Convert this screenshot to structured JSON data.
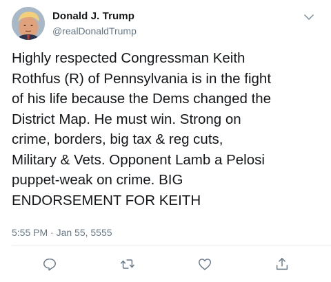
{
  "author": {
    "display_name": "Donald J. Trump",
    "handle": "@realDonaldTrump"
  },
  "tweet": {
    "text": "Highly respected Congressman Keith\nRothfus (R) of Pennsylvania is in the fight\nof his life because the Dems changed the\nDistrict Map. He must win. Strong on\ncrime, borders, big tax & reg cuts,\nMilitary & Vets. Opponent Lamb a Pelosi\npuppet-weak on crime. BIG\nENDORSEMENT FOR KEITH",
    "timestamp": "5:55 PM · Jan 55, 5555"
  },
  "icons": {
    "menu": "chevron-down-icon",
    "reply": "reply-icon",
    "retweet": "retweet-icon",
    "like": "heart-icon",
    "share": "share-icon"
  },
  "colors": {
    "text_primary": "#14171a",
    "text_secondary": "#657786",
    "icon": "#657786"
  }
}
